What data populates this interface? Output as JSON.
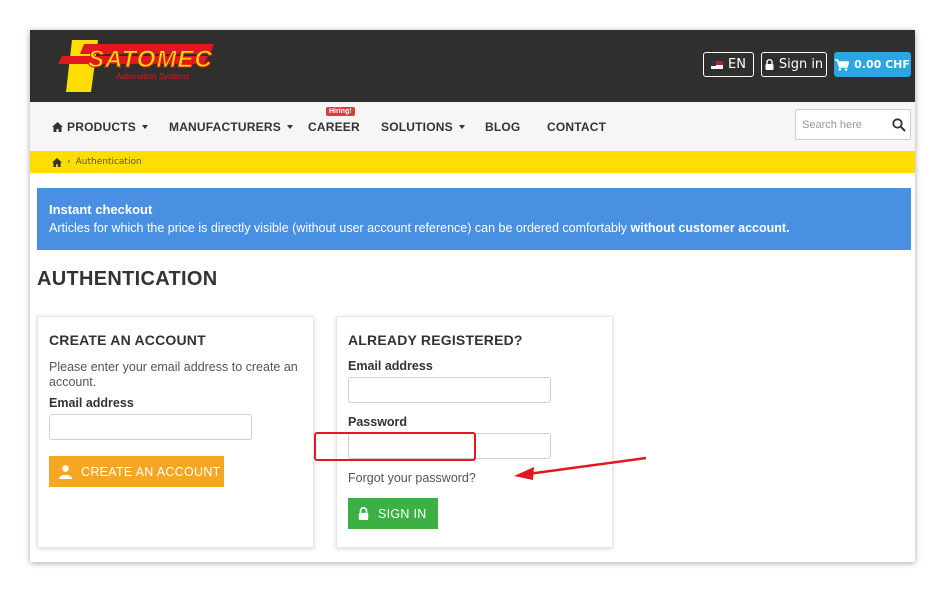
{
  "brand": {
    "name": "SATOMEC",
    "tagline": "Automation Systems",
    "colors": {
      "primary": "#ffdd00",
      "accent": "#e3171e",
      "header_bg": "#2f2f2d"
    }
  },
  "header": {
    "language": "EN",
    "signin_label": "Sign in",
    "cart_label": "0.00 CHF",
    "cart_color": "#2aa6e3"
  },
  "nav": {
    "items": [
      {
        "label": "PRODUCTS",
        "has_dropdown": true,
        "icon": "home-icon"
      },
      {
        "label": "MANUFACTURERS",
        "has_dropdown": true
      },
      {
        "label": "CAREER",
        "has_dropdown": false,
        "badge": "Hiring!"
      },
      {
        "label": "SOLUTIONS",
        "has_dropdown": true
      },
      {
        "label": "BLOG",
        "has_dropdown": false
      },
      {
        "label": "CONTACT",
        "has_dropdown": false
      }
    ],
    "search_placeholder": "Search here"
  },
  "breadcrumb": {
    "home_icon": "home-icon",
    "current": "Authentication"
  },
  "alert": {
    "title": "Instant checkout",
    "text": "Articles for which the price is directly visible (without user account reference) can be ordered comfortably ",
    "text_bold": "without customer account.",
    "color": "#4a90e2"
  },
  "page": {
    "title": "AUTHENTICATION"
  },
  "create_account": {
    "title": "CREATE AN ACCOUNT",
    "description": "Please enter your email address to create an account.",
    "email_label": "Email address",
    "email_value": "",
    "button_label": "CREATE AN ACCOUNT",
    "button_icon": "user-icon",
    "button_color": "#f5a623"
  },
  "login": {
    "title": "ALREADY REGISTERED?",
    "email_label": "Email address",
    "email_value": "",
    "password_label": "Password",
    "password_value": "",
    "forgot_label": "Forgot your password?",
    "button_label": "SIGN IN",
    "button_icon": "lock-icon",
    "button_color": "#3cb043"
  },
  "annotation": {
    "highlight": "forgot-password-link",
    "color": "#e3171e"
  }
}
